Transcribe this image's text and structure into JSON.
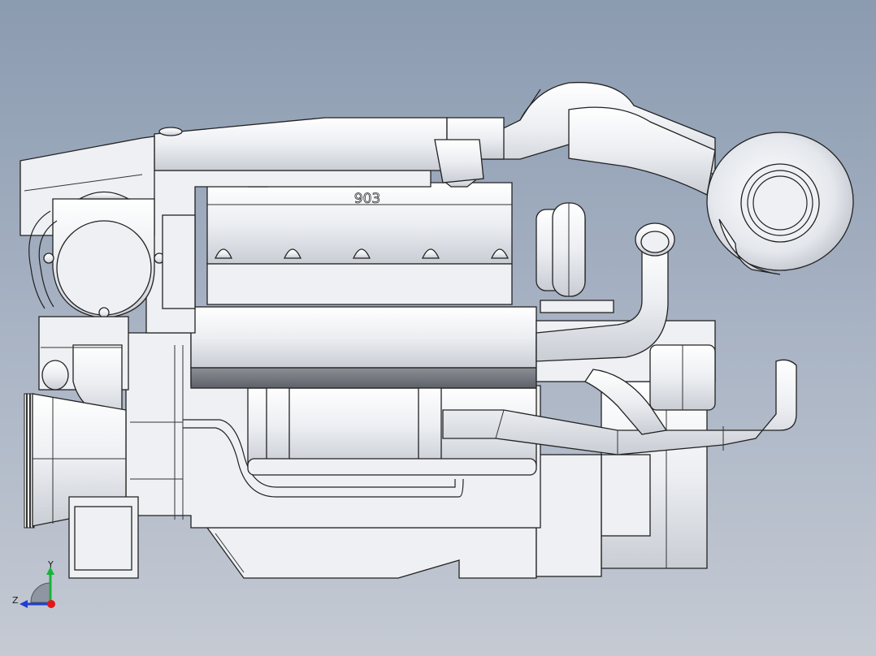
{
  "viewport": {
    "background_top": "#8b9bb0",
    "background_bottom": "#c5cad3",
    "model_color": "#eef0f3",
    "edge_color": "#222222"
  },
  "model": {
    "engraving": "903"
  },
  "triad": {
    "y_label": "Y",
    "z_label": "Z",
    "y_color": "#19b23a",
    "z_color": "#1f3fd1",
    "origin_color": "#e01818"
  }
}
